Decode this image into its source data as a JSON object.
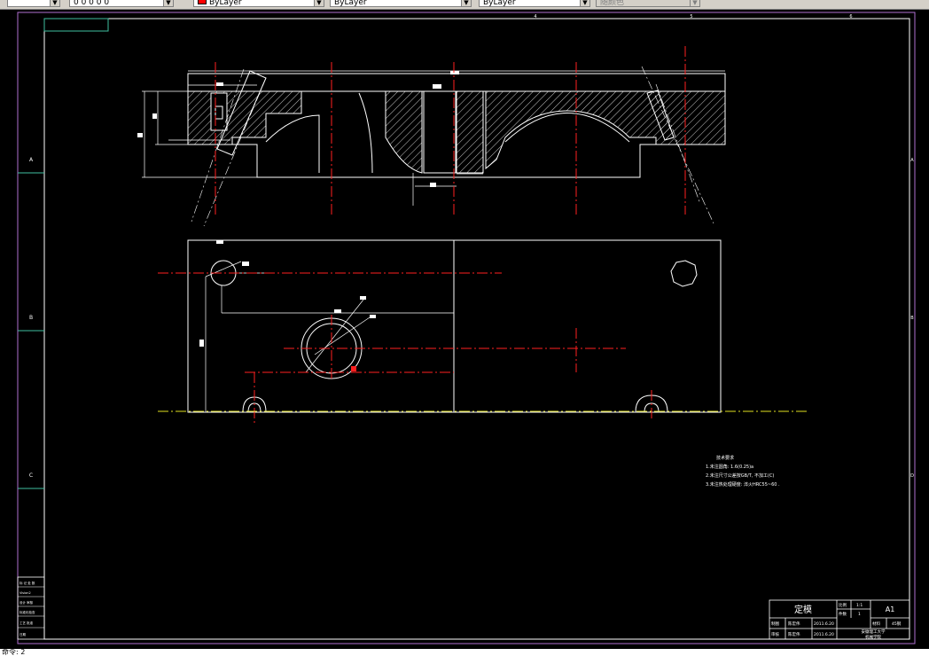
{
  "toolbar": {
    "combo1": "",
    "combo2": "0 0 0 0 0",
    "color_combo": "ByLayer",
    "linetype_combo": "ByLayer",
    "lineweight_combo": "ByLayer",
    "plotstyle_combo": "随颜色"
  },
  "border": {
    "zone_letters_left": [
      "A",
      "B",
      "C"
    ],
    "zone_letters_right": [
      "A",
      "B",
      "D"
    ],
    "zone_numbers_top": [
      "4",
      "5",
      "6"
    ]
  },
  "technical_requirements": {
    "heading": "技术要求",
    "lines": [
      "1.未注圆角: 1.6(0.25)a",
      "2.未注尺寸公差按GB/T, 不加工(C)",
      "3.未注热处理硬度: 淬火HRC55~60 ."
    ]
  },
  "title_block": {
    "part_name": "定模",
    "scale_label": "比例",
    "scale_value": "1:1",
    "qty_label": "件数",
    "qty_value": "1",
    "sheet_size": "A1",
    "material_label": "材料",
    "material_value": "45钢",
    "drawing_no": "",
    "row_labels": [
      "制图",
      "审核"
    ],
    "designer": "陈宏伟",
    "checker": "陈宏伟",
    "date1": "2011.6.20",
    "date2": "2011.6.20",
    "company": "安徽理工大学",
    "dept": "机械学院"
  },
  "revision_block": {
    "rows": [
      "标 记 处 数",
      "Vision2",
      "设计 审核",
      "标准化检查",
      "工艺 批准",
      "日期"
    ]
  },
  "command_line": "命令: 2"
}
